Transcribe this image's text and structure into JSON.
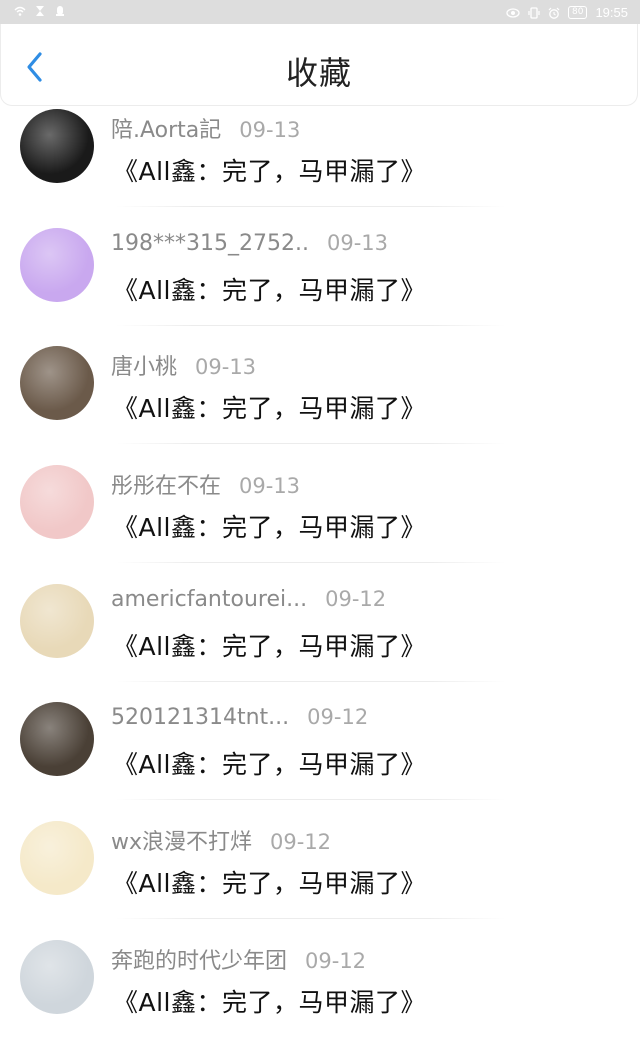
{
  "status_bar": {
    "left_icons": [
      "wifi-icon",
      "data-icon",
      "notification-icon"
    ],
    "right_icons": [
      "eye-icon",
      "vibrate-icon",
      "alarm-icon"
    ],
    "battery": "80",
    "time": "19:55"
  },
  "header": {
    "back_icon": "chevron-left-icon",
    "title": "收藏"
  },
  "favorites": [
    {
      "name": "陪.Aorta記",
      "date": "09-13",
      "work": "《All鑫：完了，马甲漏了》",
      "avatar_color": "#1a1a1a"
    },
    {
      "name": "198***315_2752..",
      "date": "09-13",
      "work": "《All鑫：完了，马甲漏了》",
      "avatar_color": "#c9a8ef"
    },
    {
      "name": "唐小桃",
      "date": "09-13",
      "work": "《All鑫：完了，马甲漏了》",
      "avatar_color": "#6b5a4a"
    },
    {
      "name": "彤彤在不在",
      "date": "09-13",
      "work": "《All鑫：完了，马甲漏了》",
      "avatar_color": "#f1c8c8"
    },
    {
      "name": "americfantourei...",
      "date": "09-12",
      "work": "《All鑫：完了，马甲漏了》",
      "avatar_color": "#e8d9b8"
    },
    {
      "name": "520121314tnt...",
      "date": "09-12",
      "work": "《All鑫：完了，马甲漏了》",
      "avatar_color": "#4a4036"
    },
    {
      "name": "wx浪漫不打烊",
      "date": "09-12",
      "work": "《All鑫：完了，马甲漏了》",
      "avatar_color": "#f5e9c9"
    },
    {
      "name": "奔跑的时代少年团",
      "date": "09-12",
      "work": "《All鑫：完了，马甲漏了》",
      "avatar_color": "#cfd6dc"
    }
  ]
}
